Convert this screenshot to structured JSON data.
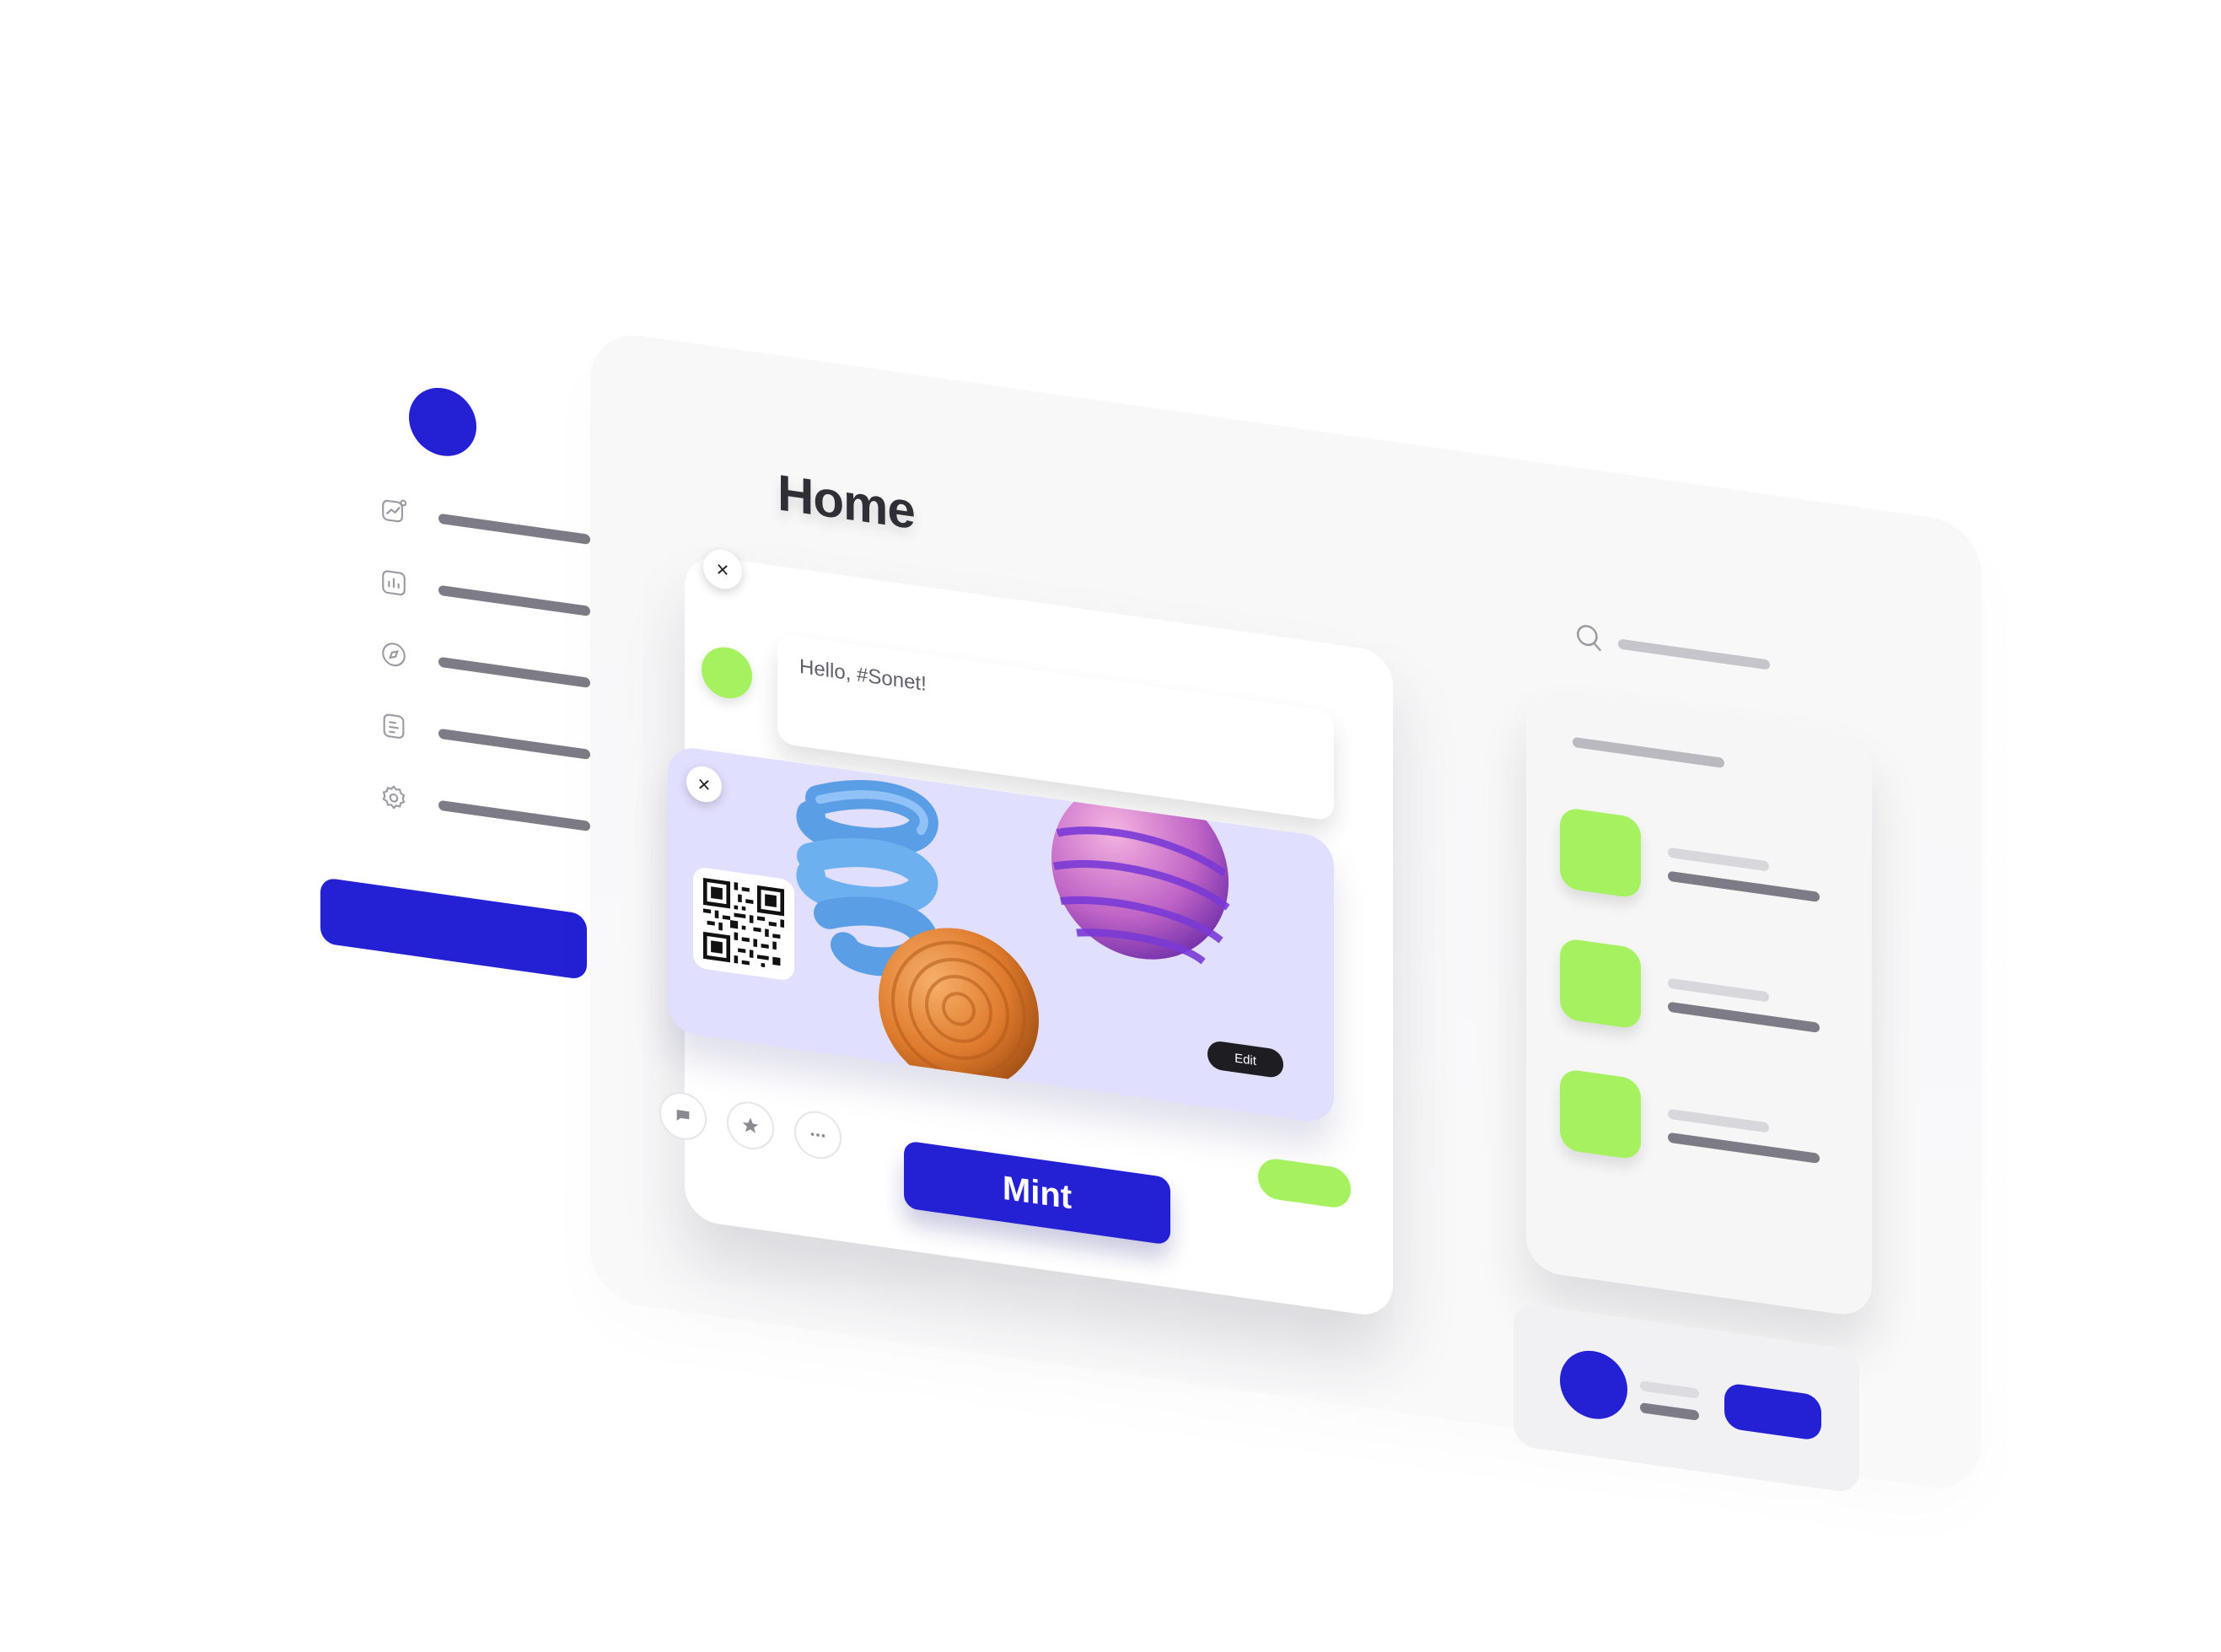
{
  "page": {
    "title": "Home"
  },
  "brand": {
    "primary": "#2420d4",
    "accent": "#a5f160",
    "text": "#2f2f36"
  },
  "sidebar": {
    "items": [
      {
        "icon": "trending-chart-icon"
      },
      {
        "icon": "bar-chart-icon"
      },
      {
        "icon": "compass-icon"
      },
      {
        "icon": "document-icon"
      },
      {
        "icon": "gear-icon"
      }
    ]
  },
  "post": {
    "compose_text": "Hello, #Sonet!",
    "edit_label": "Edit",
    "mint_label": "Mint",
    "close_glyph": "×",
    "actions": [
      "comment-icon",
      "star-icon",
      "more-icon"
    ]
  },
  "search": {
    "icon": "search-icon"
  },
  "list": {
    "rows": 3
  }
}
